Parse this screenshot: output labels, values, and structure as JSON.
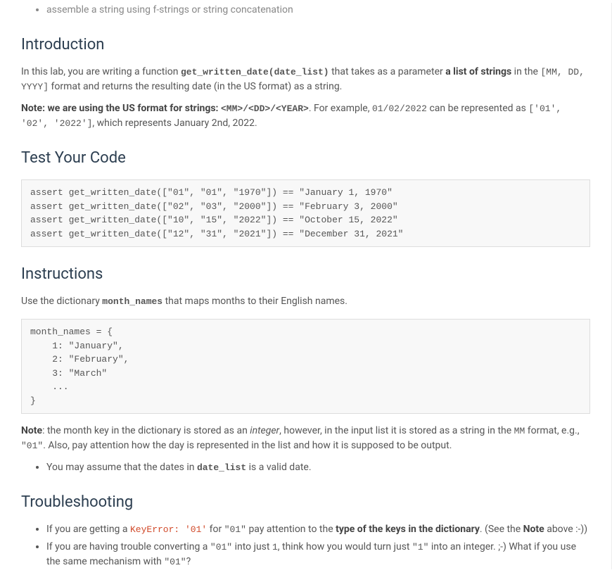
{
  "top_bullet": "assemble a string using f-strings or string concatenation",
  "h_intro": "Introduction",
  "intro_p1_a": "In this lab, you are writing a function ",
  "intro_p1_code1": "get_written_date(date_list)",
  "intro_p1_b": " that takes as a parameter ",
  "intro_p1_strong1": "a list of strings",
  "intro_p1_c": " in the ",
  "intro_p1_code2": "[MM, DD, YYYY]",
  "intro_p1_d": " format and returns the resulting date (in the US format) as a string.",
  "intro_p2_strong": "Note: we are using the US format for strings: ",
  "intro_p2_code1": "<MM>/<DD>/<YEAR>",
  "intro_p2_a": ". For example, ",
  "intro_p2_code2": "01/02/2022",
  "intro_p2_b": " can be represented as ",
  "intro_p2_code3": "['01', '02', '2022']",
  "intro_p2_c": ", which represents January 2nd, 2022.",
  "h_test": "Test Your Code",
  "code_asserts": "assert get_written_date([\"01\", \"01\", \"1970\"]) == \"January 1, 1970\"\nassert get_written_date([\"02\", \"03\", \"2000\"]) == \"February 3, 2000\"\nassert get_written_date([\"10\", \"15\", \"2022\"]) == \"October 15, 2022\"\nassert get_written_date([\"12\", \"31\", \"2021\"]) == \"December 31, 2021\"",
  "h_instr": "Instructions",
  "instr_p1_a": "Use the dictionary ",
  "instr_p1_code": "month_names",
  "instr_p1_b": " that maps months to their English names.",
  "code_monthnames": "month_names = {\n    1: \"January\",\n    2: \"February\",\n    3: \"March\"\n    ...\n}",
  "note_strong": "Note",
  "note_a": ": the month key in the dictionary is stored as an ",
  "note_em": "integer",
  "note_b": ", however, in the input list it is stored as a string in the ",
  "note_code1": "MM",
  "note_c": " format, e.g., ",
  "note_code2": "\"01\"",
  "note_d": ". Also, pay attention how the day is represented in the list and how it is supposed to be output.",
  "instr_li_a": "You may assume that the dates in ",
  "instr_li_code": "date_list",
  "instr_li_b": " is a valid date.",
  "h_trouble": "Troubleshooting",
  "t1_a": "If you are getting a ",
  "t1_err": "KeyError: '01'",
  "t1_b": " for ",
  "t1_code1": "\"01\"",
  "t1_c": " pay attention to the ",
  "t1_strong": "type of the keys in the dictionary",
  "t1_d": ". (See the ",
  "t1_strong2": "Note",
  "t1_e": " above :-))",
  "t2_a": "If you are having trouble converting a ",
  "t2_code1": "\"01\"",
  "t2_b": " into just ",
  "t2_code2": "1",
  "t2_c": ", think how you would turn just ",
  "t2_code3": "\"1\"",
  "t2_d": " into an integer. ;-) What if you use the same mechanism with ",
  "t2_code4": "\"01\"",
  "t2_e": "?"
}
